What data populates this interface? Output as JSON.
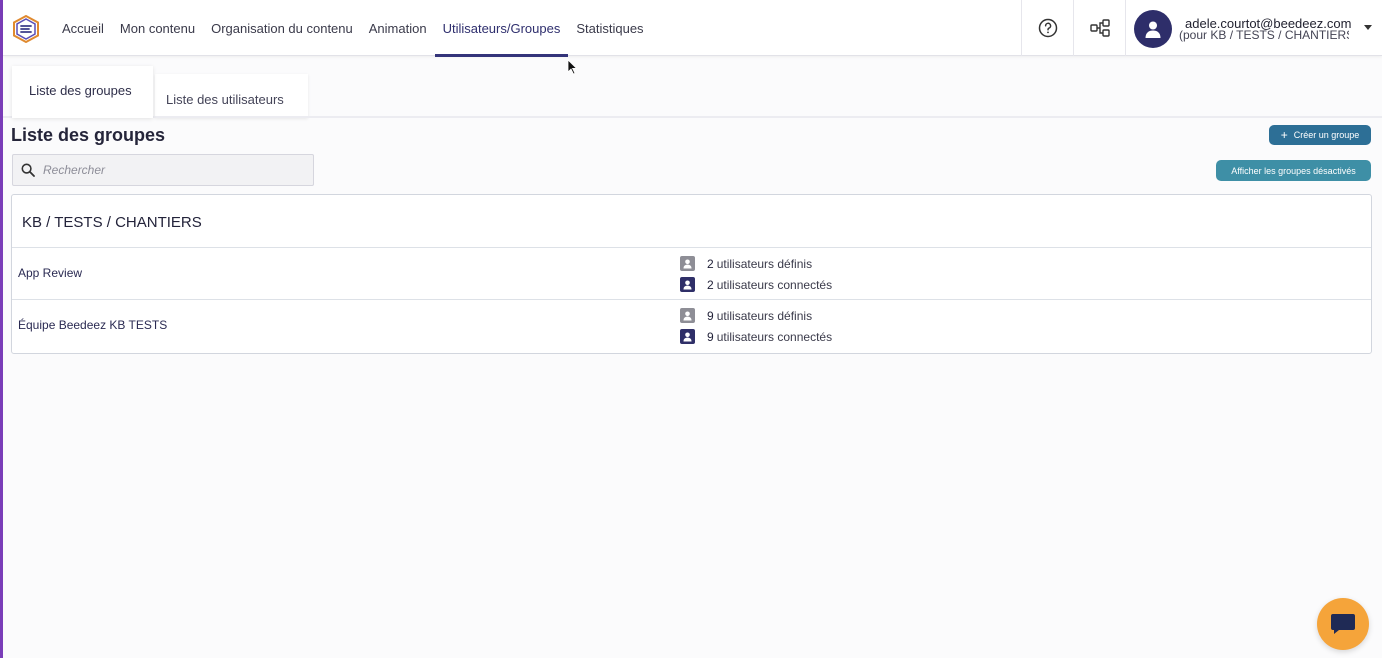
{
  "nav": {
    "logo": "beedeez-logo",
    "items": [
      {
        "label": "Accueil",
        "active": false
      },
      {
        "label": "Mon contenu",
        "active": false
      },
      {
        "label": "Organisation du contenu",
        "active": false
      },
      {
        "label": "Animation",
        "active": false
      },
      {
        "label": "Utilisateurs/Groupes",
        "active": true
      },
      {
        "label": "Statistiques",
        "active": false
      }
    ]
  },
  "user": {
    "email": "adele.courtot@beedeez.com",
    "scope": "(pour KB / TESTS / CHANTIERS)"
  },
  "tabs": [
    {
      "label": "Liste des groupes",
      "active": true
    },
    {
      "label": "Liste des utilisateurs",
      "active": false
    }
  ],
  "page": {
    "title": "Liste des groupes",
    "search_placeholder": "Rechercher",
    "create_button": "Créer un groupe",
    "show_disabled_button": "Afficher les groupes désactivés"
  },
  "panel": {
    "title": "KB / TESTS / CHANTIERS",
    "groups": [
      {
        "name": "App Review",
        "defined_count": "2",
        "defined_label": "utilisateurs définis",
        "connected_count": "2",
        "connected_label": "utilisateurs connectés"
      },
      {
        "name": "Équipe Beedeez KB TESTS",
        "defined_count": "9",
        "defined_label": "utilisateurs définis",
        "connected_count": "9",
        "connected_label": "utilisateurs connectés"
      }
    ]
  },
  "colors": {
    "accent": "#34347a",
    "primary_button": "#2d6f96",
    "secondary_button": "#3e8fa6",
    "chat": "#f5a43a"
  }
}
